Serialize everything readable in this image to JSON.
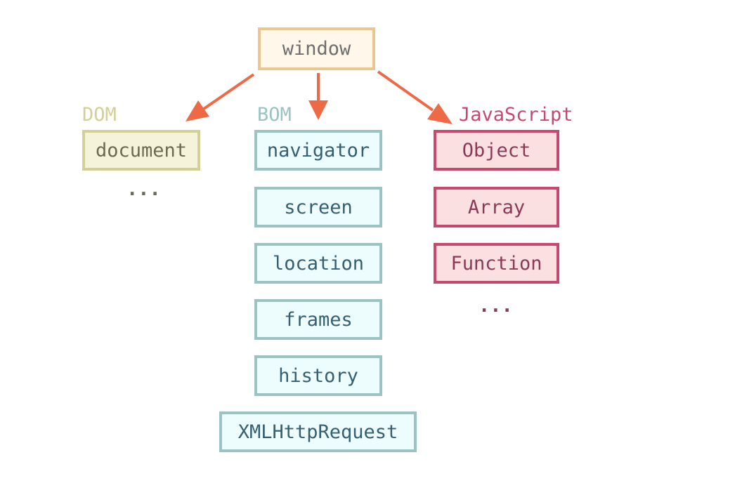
{
  "root": {
    "label": "window"
  },
  "groups": {
    "dom": {
      "title": "DOM",
      "items": [
        "document"
      ],
      "more": "..."
    },
    "bom": {
      "title": "BOM",
      "items": [
        "navigator",
        "screen",
        "location",
        "frames",
        "history",
        "XMLHttpRequest"
      ]
    },
    "js": {
      "title": "JavaScript",
      "items": [
        "Object",
        "Array",
        "Function"
      ],
      "more": "..."
    }
  },
  "colors": {
    "arrow": "#ee6a47",
    "dom": "#d3cf95",
    "bom": "#9cc3c3",
    "js": "#c9486d",
    "root": "#ecc68f"
  }
}
